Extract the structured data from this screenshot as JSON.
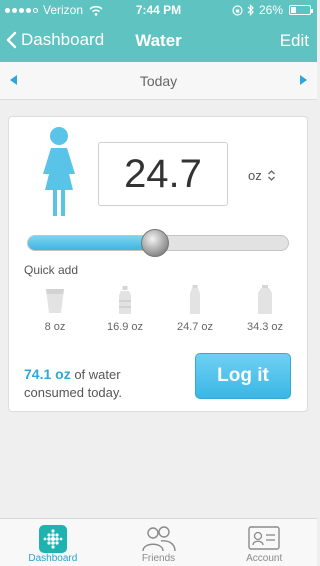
{
  "status_bar": {
    "carrier": "Verizon",
    "time": "7:44 PM",
    "battery_percent": "26%",
    "battery_level": 0.26,
    "signal_bars_filled": 4,
    "signal_bars_total": 5
  },
  "nav": {
    "back_label": "Dashboard",
    "title": "Water",
    "edit_label": "Edit"
  },
  "date_bar": {
    "label": "Today"
  },
  "entry": {
    "amount": "24.7",
    "unit": "oz",
    "slider_fraction": 0.49,
    "quick_add_label": "Quick add",
    "quick_items": [
      {
        "label": "8 oz",
        "icon": "glass-icon"
      },
      {
        "label": "16.9 oz",
        "icon": "small-bottle-icon"
      },
      {
        "label": "24.7 oz",
        "icon": "tall-bottle-icon"
      },
      {
        "label": "34.3 oz",
        "icon": "large-bottle-icon"
      }
    ],
    "consumed_value": "74.1 oz",
    "consumed_text_1": "of water",
    "consumed_text_2": "consumed today.",
    "log_button_label": "Log it"
  },
  "tabs": [
    {
      "label": "Dashboard",
      "icon": "dashboard-icon",
      "active": true
    },
    {
      "label": "Friends",
      "icon": "friends-icon",
      "active": false
    },
    {
      "label": "Account",
      "icon": "account-icon",
      "active": false
    }
  ],
  "colors": {
    "header": "#5fc3c1",
    "accent": "#2fa7da",
    "person_icon": "#5ac4e8"
  }
}
